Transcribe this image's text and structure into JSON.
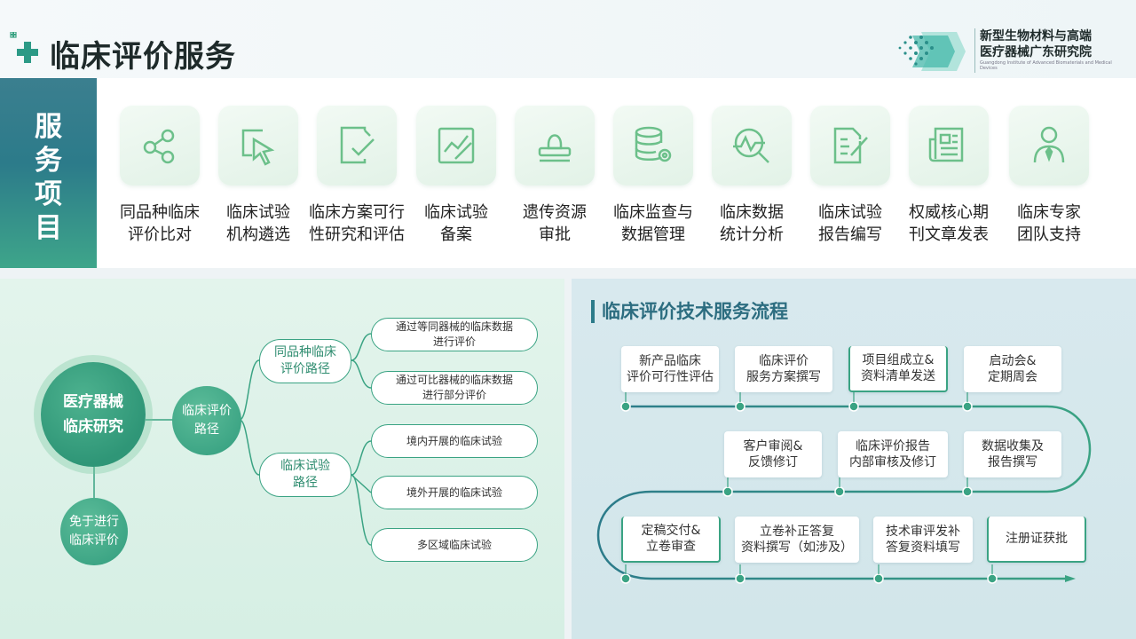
{
  "header": {
    "title": "临床评价服务",
    "logo_cn_line1": "新型生物材料与高端",
    "logo_cn_line2": "医疗器械广东研究院",
    "logo_en": "Guangdong Institute of Advanced Biomaterials and Medical Devices"
  },
  "services": {
    "tag": "服务项目",
    "items": [
      {
        "line1": "同品种临床",
        "line2": "评价比对",
        "icon": "share-nodes-icon"
      },
      {
        "line1": "临床试验",
        "line2": "机构遴选",
        "icon": "cursor-select-icon"
      },
      {
        "line1": "临床方案可行",
        "line2": "性研究和评估",
        "icon": "document-check-icon"
      },
      {
        "line1": "临床试验",
        "line2": "备案",
        "icon": "chart-edit-icon"
      },
      {
        "line1": "遗传资源",
        "line2": "审批",
        "icon": "stamp-icon"
      },
      {
        "line1": "临床监查与",
        "line2": "数据管理",
        "icon": "database-gear-icon"
      },
      {
        "line1": "临床数据",
        "line2": "统计分析",
        "icon": "analytics-magnifier-icon"
      },
      {
        "line1": "临床试验",
        "line2": "报告编写",
        "icon": "report-pen-icon"
      },
      {
        "line1": "权威核心期",
        "line2": "刊文章发表",
        "icon": "newspaper-icon"
      },
      {
        "line1": "临床专家",
        "line2": "团队支持",
        "icon": "expert-person-icon"
      }
    ]
  },
  "mindmap": {
    "center_line1": "医疗器械",
    "center_line2": "临床研究",
    "exempt_line1": "免于进行",
    "exempt_line2": "临床评价",
    "eval_line1": "临床评价",
    "eval_line2": "路径",
    "same_line1": "同品种临床",
    "same_line2": "评价路径",
    "trial_line1": "临床试验",
    "trial_line2": "路径",
    "leaf1_line1": "通过等同器械的临床数据",
    "leaf1_line2": "进行评价",
    "leaf2_line1": "通过可比器械的临床数据",
    "leaf2_line2": "进行部分评价",
    "leaf3": "境内开展的临床试验",
    "leaf4": "境外开展的临床试验",
    "leaf5": "多区域临床试验"
  },
  "flow": {
    "title": "临床评价技术服务流程",
    "steps": [
      {
        "line1": "新产品临床",
        "line2": "评价可行性评估"
      },
      {
        "line1": "临床评价",
        "line2": "服务方案撰写"
      },
      {
        "line1": "项目组成立&",
        "line2": "资料清单发送"
      },
      {
        "line1": "启动会&",
        "line2": "定期周会"
      },
      {
        "line1": "数据收集及",
        "line2": "报告撰写"
      },
      {
        "line1": "临床评价报告",
        "line2": "内部审核及修订"
      },
      {
        "line1": "客户审阅&",
        "line2": "反馈修订"
      },
      {
        "line1": "定稿交付&",
        "line2": "立卷审查"
      },
      {
        "line1": "立卷补正答复",
        "line2": "资料撰写（如涉及）"
      },
      {
        "line1": "技术审评发补",
        "line2": "答复资料填写"
      },
      {
        "line1": "注册证获批",
        "line2": ""
      }
    ]
  },
  "colors": {
    "primary_teal": "#2c7b8a",
    "green": "#3aa383",
    "dark_green": "#2e8c6f"
  }
}
